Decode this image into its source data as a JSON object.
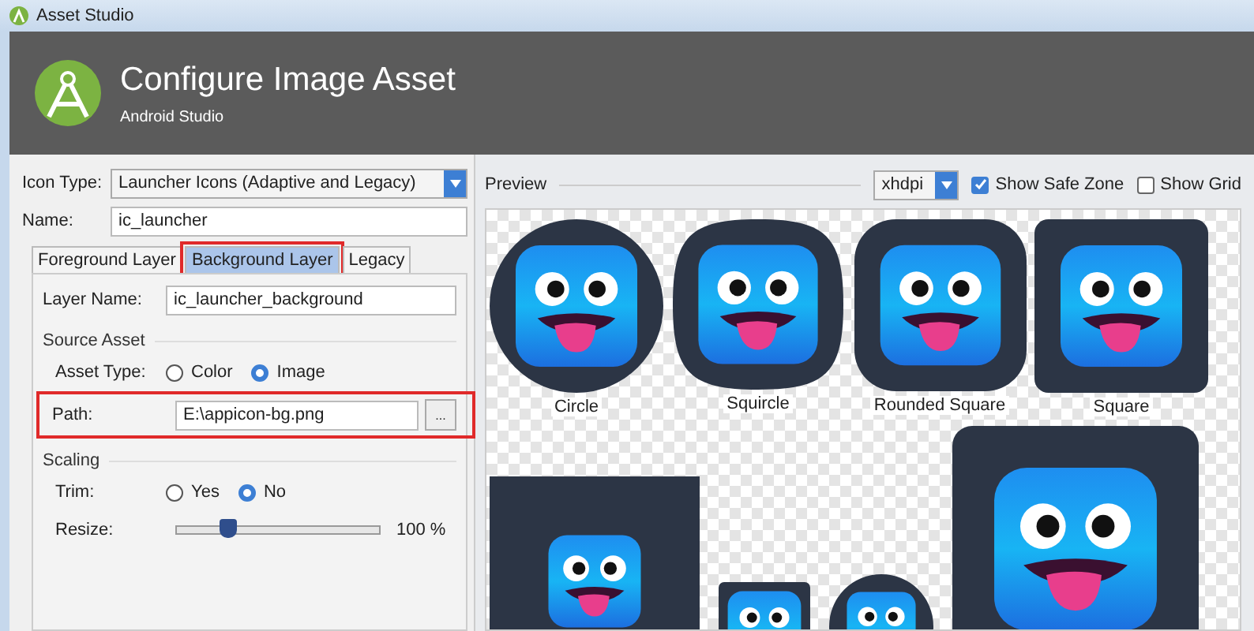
{
  "window": {
    "title": "Asset Studio"
  },
  "header": {
    "title": "Configure Image Asset",
    "subtitle": "Android Studio"
  },
  "icon_type": {
    "label": "Icon Type:",
    "value": "Launcher Icons (Adaptive and Legacy)"
  },
  "name": {
    "label": "Name:",
    "value": "ic_launcher"
  },
  "tabs": [
    {
      "label": "Foreground Layer",
      "selected": false,
      "highlighted": false
    },
    {
      "label": "Background Layer",
      "selected": true,
      "highlighted": true
    },
    {
      "label": "Legacy",
      "selected": false,
      "highlighted": false
    }
  ],
  "layer_name": {
    "label": "Layer Name:",
    "value": "ic_launcher_background"
  },
  "source_asset": {
    "title": "Source Asset",
    "asset_type": {
      "label": "Asset Type:",
      "options": [
        {
          "label": "Color",
          "selected": false
        },
        {
          "label": "Image",
          "selected": true
        }
      ]
    },
    "path": {
      "label": "Path:",
      "value": "E:\\appicon-bg.png",
      "browse": "...",
      "highlighted": true
    }
  },
  "scaling": {
    "title": "Scaling",
    "trim": {
      "label": "Trim:",
      "options": [
        {
          "label": "Yes",
          "selected": false
        },
        {
          "label": "No",
          "selected": true
        }
      ]
    },
    "resize": {
      "label": "Resize:",
      "level": 0.25,
      "reading": "100 %"
    }
  },
  "preview": {
    "title": "Preview",
    "density": "xhdpi",
    "options": [
      {
        "label": "Show Safe Zone",
        "checked": true
      },
      {
        "label": "Show Grid",
        "checked": false
      }
    ],
    "top_row": [
      {
        "kind": "circle",
        "label": "Circle"
      },
      {
        "kind": "squircle",
        "label": "Squircle"
      },
      {
        "kind": "rounded",
        "label": "Rounded Square"
      },
      {
        "kind": "square",
        "label": "Square"
      }
    ],
    "bottom_row": [
      {
        "kind": "full_bleed"
      },
      {
        "kind": "legacy_square"
      },
      {
        "kind": "legacy_round"
      },
      {
        "kind": "large_rounded"
      }
    ]
  }
}
